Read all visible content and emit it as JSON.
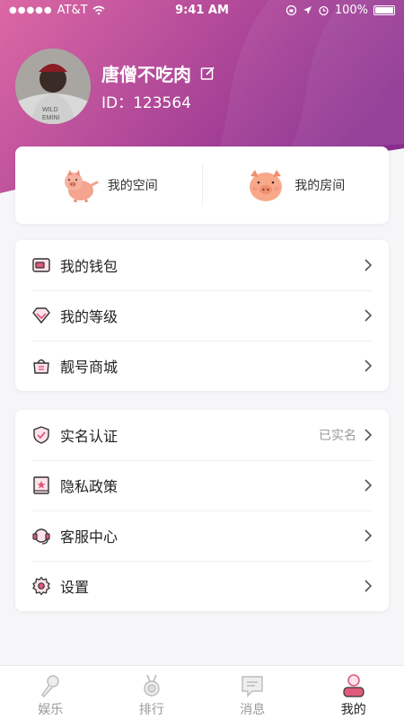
{
  "status_bar": {
    "signal": "●●●●●",
    "carrier": "AT&T",
    "time": "9:41 AM",
    "battery_pct": "100%"
  },
  "profile": {
    "name": "唐僧不吃肉",
    "id_text": "ID：123564",
    "avatar_shirt_text_1": "WILD",
    "avatar_shirt_text_2": "EMINI"
  },
  "spaces": [
    {
      "label": "我的空间"
    },
    {
      "label": "我的房间"
    }
  ],
  "menu_group_1": [
    {
      "label": "我的钱包",
      "icon": "wallet-icon"
    },
    {
      "label": "我的等级",
      "icon": "diamond-icon"
    },
    {
      "label": "靓号商城",
      "icon": "shop-bag-icon"
    }
  ],
  "menu_group_2": [
    {
      "label": "实名认证",
      "icon": "shield-check-icon",
      "extra": "已实名"
    },
    {
      "label": "隐私政策",
      "icon": "book-star-icon"
    },
    {
      "label": "客服中心",
      "icon": "headset-icon"
    },
    {
      "label": "设置",
      "icon": "gear-icon"
    }
  ],
  "tabs": [
    {
      "label": "娱乐",
      "icon": "microphone-icon",
      "active": false
    },
    {
      "label": "排行",
      "icon": "medal-icon",
      "active": false
    },
    {
      "label": "消息",
      "icon": "message-icon",
      "active": false
    },
    {
      "label": "我的",
      "icon": "profile-icon",
      "active": true
    }
  ],
  "colors": {
    "gradient_start": "#d9649f",
    "gradient_end": "#8a2d8f",
    "accent_pink": "#e05a7c",
    "icon_outline": "#333333"
  }
}
